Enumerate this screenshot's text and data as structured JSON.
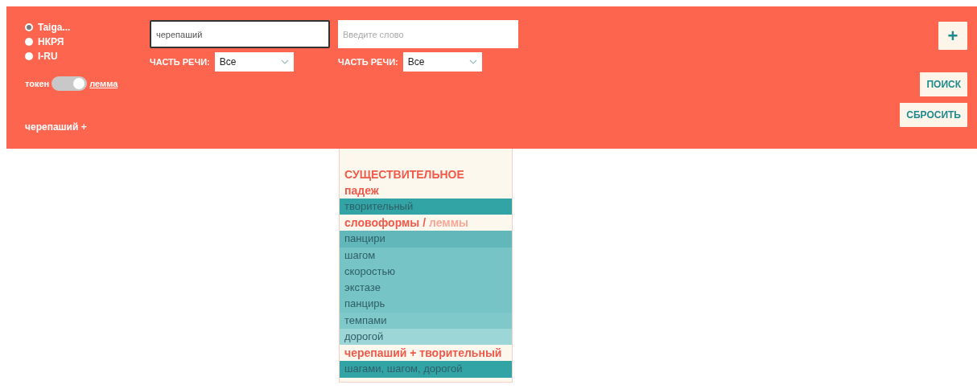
{
  "sources": [
    {
      "label": "Taiga...",
      "selected": true
    },
    {
      "label": "НКРЯ",
      "selected": false
    },
    {
      "label": "I-RU",
      "selected": false
    }
  ],
  "mode_toggle": {
    "left_label": "токен",
    "right_label": "лемма",
    "on": true
  },
  "query_words": [
    {
      "value": "черепаший",
      "focused": true,
      "pos_label": "ЧАСТЬ РЕЧИ:",
      "pos_value": "Все"
    },
    {
      "placeholder": "Введите слово",
      "focused": false,
      "pos_label": "ЧАСТЬ РЕЧИ:",
      "pos_value": "Все"
    }
  ],
  "query_summary": "черепаший +",
  "buttons": {
    "add": "+",
    "search": "ПОИСК",
    "reset": "СБРОСИТЬ"
  },
  "result_panel": {
    "pos_heading": "СУЩЕСТВИТЕЛЬНОЕ",
    "case_heading": "падеж",
    "case_value": "творительный",
    "wordforms_label": "словоформы",
    "separator": "/",
    "lemmas_label": "леммы",
    "lemmas_selected": false,
    "wordforms": [
      {
        "text": "панцири",
        "color": "#62b7ba"
      },
      {
        "text": "шагом",
        "color": "#76c4c6"
      },
      {
        "text": "скоростью",
        "color": "#76c4c6"
      },
      {
        "text": "экстазе",
        "color": "#76c4c6"
      },
      {
        "text": "панцирь",
        "color": "#76c4c6"
      },
      {
        "text": "темпами",
        "color": "#80c9ca"
      },
      {
        "text": "дорогой",
        "color": "#9dd6d6"
      }
    ],
    "combo_heading": "черепаший + творительный",
    "combo_value": "шагами, шагом, дорогой"
  }
}
